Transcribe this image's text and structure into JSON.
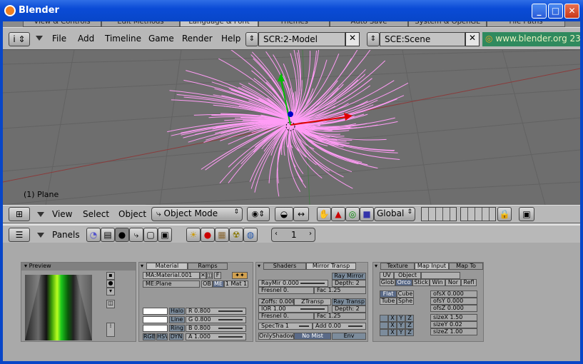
{
  "window": {
    "title": "Blender"
  },
  "prefs_tabs": [
    "View & Controls",
    "Edit Methods",
    "Language & Font",
    "Themes",
    "Auto Save",
    "System & OpenGL",
    "File Paths"
  ],
  "info_header": {
    "menus": [
      "File",
      "Add",
      "Timeline",
      "Game",
      "Render",
      "Help"
    ],
    "screen": "SCR:2-Model",
    "scene": "SCE:Scene",
    "site": "www.blender.org 23"
  },
  "viewport": {
    "object_label": "(1) Plane"
  },
  "view3d_header": {
    "menus": [
      "View",
      "Select",
      "Object"
    ],
    "mode": "Object Mode",
    "orientation": "Global"
  },
  "buttons_header": {
    "panels_label": "Panels",
    "frame": "1"
  },
  "preview": {
    "title": "Preview"
  },
  "material_panel": {
    "tabs": [
      "Material",
      "Ramps"
    ],
    "ma_name": "MA:Material.001",
    "f_label": "F",
    "me_name": "ME:Plane",
    "ob": "OB",
    "me": "ME",
    "mat_count": "1 Mat 1",
    "halo": "Halo",
    "line": "Line",
    "ring": "Ring",
    "r": "R 0.800",
    "g": "G 0.800",
    "b": "B 0.800",
    "rgb": "RGB",
    "hsv": "HSV",
    "dyn": "DYN",
    "alpha": "A 1.000"
  },
  "shaders_panel": {
    "tabs": [
      "Shaders",
      "Mirror Transp"
    ],
    "ray_mirror": "Ray Mirror",
    "raymir": "RayMir 0.000",
    "depth1": "Depth: 2",
    "fresnel1": "Fresnel 0.",
    "fac1": "Fac 1.25",
    "zoffs": "Zoffs: 0.000",
    "ztransp": "ZTransp",
    "ray_transp": "Ray Transp",
    "ior": "IOR 1.00",
    "depth2": "Depth: 2",
    "fresnel2": "Fresnel 0.",
    "fac2": "Fac 1.25",
    "spectra": "SpecTra 1",
    "add": "Add 0.00",
    "onlyshadow": "OnlyShadow",
    "nomist": "No Mist",
    "env": "Env"
  },
  "texture_panel": {
    "tabs": [
      "Texture",
      "Map Input",
      "Map To"
    ],
    "uv": "UV",
    "object": "Object",
    "glob": "Glob",
    "orco": "Orco",
    "stick": "Stick",
    "win": "Win",
    "nor": "Nor",
    "refl": "Refl",
    "flat": "Flat",
    "cube": "Cube",
    "tube": "Tube",
    "sphe": "Sphe",
    "ofsx": "ofsX 0.000",
    "ofsy": "ofsY 0.000",
    "ofsz": "ofsZ 0.000",
    "sizex": "sizeX 1.50",
    "sizey": "sizeY 0.02",
    "sizez": "sizeZ 1.00",
    "axes": [
      "X",
      "Y",
      "Z"
    ]
  },
  "colors": {
    "title_blue": "#0a4bd6",
    "hair": "#ff9cf5",
    "green_site": "#3a8a6a"
  }
}
